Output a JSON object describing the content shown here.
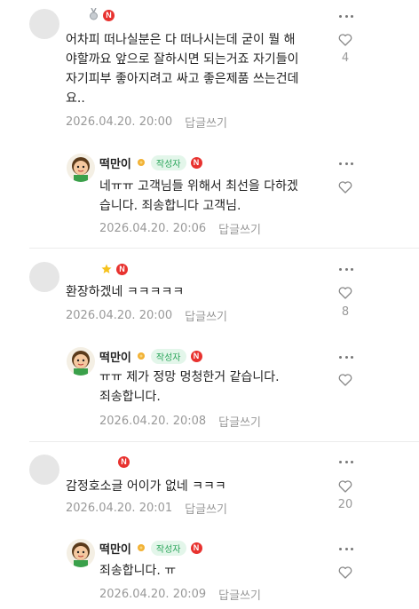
{
  "comments": [
    {
      "text_lines": [
        "어차피 떠나실분은 다 떠나시는데 굳이 뭘 해",
        "야할까요 앞으로 잘하시면 되는거죠 자기들이",
        "자기피부 좋아지려고 싸고 좋은제품 쓰는건데",
        "요.."
      ],
      "date": "2026.04.20. 20:00",
      "reply_label": "답글쓰기",
      "like_count": "4",
      "reply": {
        "author": "떡만이",
        "tag": "작성자",
        "text_lines": [
          "네ㅠㅠ 고객님들 위해서 최선을 다하겠",
          "습니다. 죄송합니다 고객님."
        ],
        "date": "2026.04.20. 20:06",
        "reply_label": "답글쓰기"
      }
    },
    {
      "text_lines": [
        "환장하겠네 ㅋㅋㅋㅋㅋ"
      ],
      "date": "2026.04.20. 20:00",
      "reply_label": "답글쓰기",
      "like_count": "8",
      "reply": {
        "author": "떡만이",
        "tag": "작성자",
        "text_lines": [
          "ㅠㅠ 제가 정망 멍청한거 같습니다.",
          "죄송합니다."
        ],
        "date": "2026.04.20. 20:08",
        "reply_label": "답글쓰기"
      }
    },
    {
      "text_lines": [
        "감정호소글 어이가 없네 ㅋㅋㅋ"
      ],
      "date": "2026.04.20. 20:01",
      "reply_label": "답글쓰기",
      "like_count": "20",
      "reply": {
        "author": "떡만이",
        "tag": "작성자",
        "text_lines": [
          "죄송합니다. ㅠ"
        ],
        "date": "2026.04.20. 20:09",
        "reply_label": "답글쓰기"
      }
    }
  ],
  "badge_letter": "N",
  "colors": {
    "accent_red": "#e8322f",
    "tag_green": "#2aa55a",
    "muted": "#999999"
  }
}
